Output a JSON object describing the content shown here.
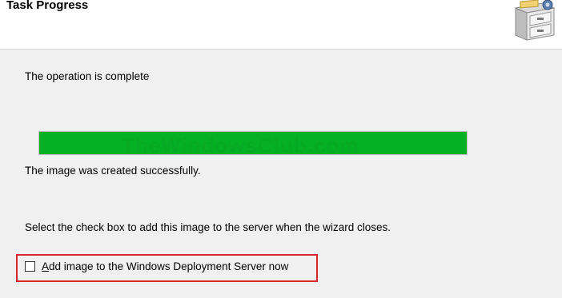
{
  "header": {
    "title": "Task Progress",
    "icon": "file-cabinet-icon"
  },
  "status": {
    "message": "The operation is complete",
    "progress": 1.0,
    "progress_color": "#06b025",
    "watermark": "TheWindowsClub.com",
    "result": "The image was created successfully."
  },
  "instruction": "Select the check box to add this image to the server when the wizard closes.",
  "checkbox": {
    "accelerator": "A",
    "label_rest": "dd image to the Windows Deployment Server now",
    "checked": false
  },
  "highlight_color": "#d8262f"
}
